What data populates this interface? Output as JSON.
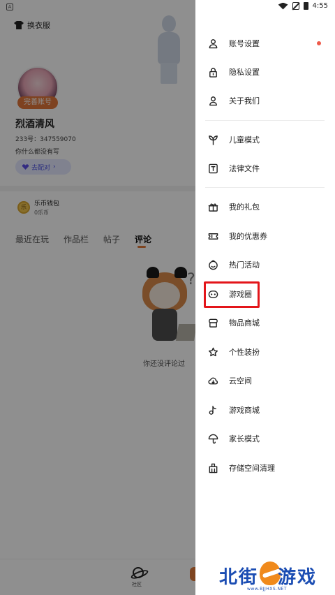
{
  "background_page": {
    "status_badge": "A",
    "dress_up_label": "换衣服",
    "complete_badge": "完善账号",
    "username": "烈酒清风",
    "user_id": "233号：347559070",
    "bio": "你什么都没有写",
    "pair_button": "去配对",
    "wallet_title": "乐币钱包",
    "wallet_balance": "0乐币",
    "coin_glyph": "乐",
    "tabs": [
      "最近在玩",
      "作品栏",
      "帖子",
      "评论"
    ],
    "active_tab": "评论",
    "empty_tip": "你还没评论过",
    "bottom_nav": [
      "社区"
    ]
  },
  "status_bar": {
    "time": "4:55"
  },
  "drawer": {
    "groups": [
      [
        {
          "label": "账号设置",
          "icon": "user-icon",
          "dot": true
        },
        {
          "label": "隐私设置",
          "icon": "lock-icon"
        },
        {
          "label": "关于我们",
          "icon": "about-icon"
        }
      ],
      [
        {
          "label": "儿童模式",
          "icon": "sprout-icon"
        },
        {
          "label": "法律文件",
          "icon": "document-icon"
        }
      ],
      [
        {
          "label": "我的礼包",
          "icon": "gift-icon"
        },
        {
          "label": "我的优惠券",
          "icon": "ticket-icon"
        },
        {
          "label": "热门活动",
          "icon": "smile-icon"
        },
        {
          "label": "游戏圈",
          "icon": "game-circle-icon",
          "highlighted": true
        },
        {
          "label": "物品商城",
          "icon": "shop-icon"
        },
        {
          "label": "个性装扮",
          "icon": "star-icon"
        },
        {
          "label": "云空间",
          "icon": "cloud-icon"
        },
        {
          "label": "游戏商城",
          "icon": "music-note-icon"
        },
        {
          "label": "家长模式",
          "icon": "umbrella-icon"
        },
        {
          "label": "存储空间清理",
          "icon": "broom-icon"
        }
      ]
    ],
    "accent_dot_color": "#ee5a4a",
    "highlight_color": "#e3151a"
  },
  "watermark": {
    "left_text": "北街",
    "right_text": "游戏",
    "url": "www.BJJHXS.NET"
  }
}
